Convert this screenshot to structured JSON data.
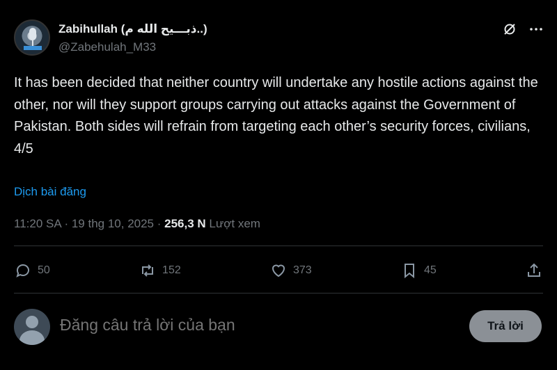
{
  "author": {
    "display_name": "Zabihullah (ذبـــيح الله م..)",
    "handle": "@Zabehulah_M33"
  },
  "header_icons": [
    "grok-icon",
    "more-icon"
  ],
  "tweet": {
    "text": "It has been decided that neither country will undertake any hostile actions against the other, nor will they support groups carrying out attacks against the Government of Pakistan. Both sides will refrain from targeting each other’s security forces, civilians,\n4/5",
    "translate_label": "Dịch bài đăng",
    "time": "11:20 SA · 19 thg 10, 2025 · ",
    "views_count": "256,3 N",
    "views_label": " Lượt xem"
  },
  "actions": {
    "replies": "50",
    "reposts": "152",
    "likes": "373",
    "bookmarks": "45"
  },
  "reply_box": {
    "placeholder": "Đăng câu trả lời của bạn",
    "button_label": "Trả lời"
  }
}
